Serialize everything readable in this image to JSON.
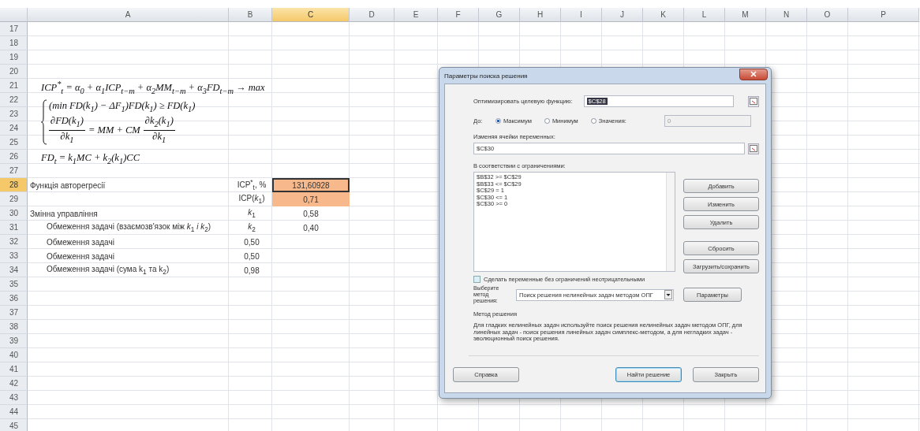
{
  "sheet": {
    "columns": [
      {
        "label": "A",
        "selected": false
      },
      {
        "label": "B",
        "selected": false
      },
      {
        "label": "C",
        "selected": true
      },
      {
        "label": "D",
        "selected": false
      },
      {
        "label": "E",
        "selected": false
      },
      {
        "label": "F",
        "selected": false
      },
      {
        "label": "G",
        "selected": false
      },
      {
        "label": "H",
        "selected": false
      },
      {
        "label": "I",
        "selected": false
      },
      {
        "label": "J",
        "selected": false
      },
      {
        "label": "K",
        "selected": false
      },
      {
        "label": "L",
        "selected": false
      },
      {
        "label": "M",
        "selected": false
      },
      {
        "label": "N",
        "selected": false
      },
      {
        "label": "O",
        "selected": false
      },
      {
        "label": "P",
        "selected": false
      }
    ],
    "rows": [
      {
        "number": "17",
        "selected": false
      },
      {
        "number": "18",
        "selected": false
      },
      {
        "number": "19",
        "selected": false
      },
      {
        "number": "20",
        "selected": false
      },
      {
        "number": "21",
        "selected": false
      },
      {
        "number": "22",
        "selected": false
      },
      {
        "number": "23",
        "selected": false
      },
      {
        "number": "24",
        "selected": false
      },
      {
        "number": "25",
        "selected": false
      },
      {
        "number": "26",
        "selected": false
      },
      {
        "number": "27",
        "selected": false
      },
      {
        "number": "28",
        "selected": true,
        "a": "Функція авторегресії",
        "a_indent": false,
        "b": "ICP$^{*}$$_{t}$, %",
        "c": "131,60928",
        "c_highlight": true,
        "c_active": true
      },
      {
        "number": "29",
        "selected": false,
        "b": "ICP(*k*$_{1}$)",
        "c": "0,71",
        "c_highlight": true,
        "c_active": false
      },
      {
        "number": "30",
        "selected": false,
        "a": "Змінна управління",
        "a_indent": false,
        "b": "*k*$_{1}$",
        "c": "0,58",
        "c_highlight": false,
        "c_active": false
      },
      {
        "number": "31",
        "selected": false,
        "a": "Обмеження задачі (взаємозв'язок між *k*$_{1}$ *і k*$_{2}$)",
        "a_indent": true,
        "b": "*k*$_{2}$",
        "c": "0,40",
        "c_highlight": false,
        "c_active": false
      },
      {
        "number": "32",
        "selected": false,
        "a": "Обмеження задачі",
        "a_indent": true,
        "b": "0,50"
      },
      {
        "number": "33",
        "selected": false,
        "a": "Обмеження задачі",
        "a_indent": true,
        "b": "0,50"
      },
      {
        "number": "34",
        "selected": false,
        "a": "Обмеження задачі (сума k$_{1}$ та k$_{2}$)",
        "a_indent": true,
        "b": "0,98"
      },
      {
        "number": "35",
        "selected": false
      },
      {
        "number": "36",
        "selected": false
      },
      {
        "number": "37",
        "selected": false
      },
      {
        "number": "38",
        "selected": false
      },
      {
        "number": "39",
        "selected": false
      },
      {
        "number": "40",
        "selected": false
      },
      {
        "number": "41",
        "selected": false
      },
      {
        "number": "42",
        "selected": false
      },
      {
        "number": "43",
        "selected": false
      },
      {
        "number": "44",
        "selected": false
      },
      {
        "number": "45",
        "selected": false
      }
    ]
  },
  "formulas": [
    {
      "kind": "line",
      "text": "ICP$^{*}$$_{t}$ = α$_{0}$ + α$_{1}$ICP$_{t−m}$ + α$_{2}$MM$_{t−m}$ + α$_{3}$FD$_{t−m}$ → max"
    },
    {
      "kind": "system",
      "lines": [
        {
          "kind": "line",
          "text": "(min FD(k$_{1}$) − ΔF$_{1}$)FD(k$_{1}$) ≥ FD(k$_{1}$)"
        },
        {
          "kind": "fractions",
          "parts": [
            {
              "num": "∂FD(k$_{1}$)",
              "den": "∂k$_{1}$"
            },
            {
              "text": "= MM + CM"
            },
            {
              "num": "∂k$_{2}$(k$_{1}$)",
              "den": "∂k$_{1}$"
            }
          ]
        }
      ]
    },
    {
      "kind": "line",
      "text": "FD$_{t}$ = k$_{1}$MC + k$_{2}$(k$_{1}$)CC"
    }
  ],
  "dialog": {
    "title": "Параметры поиска решения",
    "objective_label": "Оптимизировать целевую функцию:",
    "objective_value": "$C$28",
    "to_label": "До:",
    "targets": [
      {
        "label": "Максимум",
        "selected": true
      },
      {
        "label": "Минимум",
        "selected": false
      },
      {
        "label": "Значения:",
        "selected": false
      }
    ],
    "target_value": "0",
    "variables_label": "Изменяя ячейки переменных:",
    "variables_value": "$C$30",
    "constraints_label": "В соответствии с ограничениями:",
    "constraints": [
      "$B$32 >= $C$29",
      "$B$33 <= $C$29",
      "$C$29 = 1",
      "$C$30 <= 1",
      "$C$30 >= 0"
    ],
    "side_buttons": [
      "Добавить",
      "Изменить",
      "Удалить",
      "Сбросить",
      "Загрузить/сохранить"
    ],
    "nonnegative": {
      "label": "Сделать переменные без ограничений неотрицательными",
      "checked": false
    },
    "method_label": "Выберите метод решения:",
    "method_value": "Поиск решения нелинейных задач методом ОПГ",
    "options_button": "Параметры",
    "method_group": {
      "title": "Метод решения",
      "text": "Для гладких нелинейных задач используйте поиск решения нелинейных задач методом ОПГ, для линейных задач - поиск решения линейных задач симплекс-методом, а для негладких задач - эволюционный поиск решения."
    },
    "footer_buttons": [
      {
        "label": "Справка",
        "default": false
      },
      {
        "label": "Найти решение",
        "default": true
      },
      {
        "label": "Закрыть",
        "default": false
      }
    ]
  }
}
